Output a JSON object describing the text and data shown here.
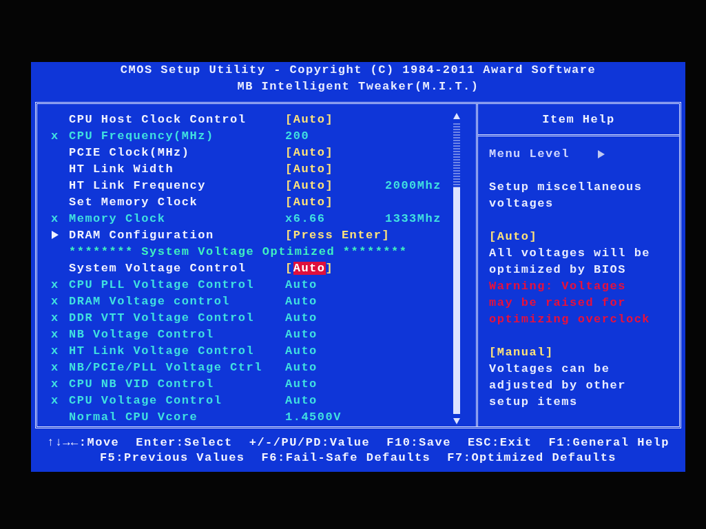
{
  "header": {
    "title": "CMOS Setup Utility - Copyright (C) 1984-2011 Award Software",
    "subtitle": "MB Intelligent Tweaker(M.I.T.)"
  },
  "settings": [
    {
      "kind": "setting",
      "label": "CPU Host Clock Control",
      "value": "[Auto]",
      "disabled": false,
      "selected": false
    },
    {
      "kind": "setting",
      "prefix": "x",
      "label": "CPU Frequency(MHz)",
      "value": "200",
      "disabled": true,
      "selected": false
    },
    {
      "kind": "setting",
      "label": "PCIE Clock(MHz)",
      "value": "[Auto]",
      "disabled": false,
      "selected": false
    },
    {
      "kind": "setting",
      "label": "HT Link Width",
      "value": "[Auto]",
      "disabled": false,
      "selected": false
    },
    {
      "kind": "setting",
      "label": "HT Link Frequency",
      "value": "[Auto]",
      "extra": "2000Mhz",
      "disabled": false,
      "selected": false
    },
    {
      "kind": "setting",
      "label": "Set Memory Clock",
      "value": "[Auto]",
      "disabled": false,
      "selected": false
    },
    {
      "kind": "setting",
      "prefix": "x",
      "label": "Memory Clock",
      "value": "x6.66",
      "extra": "1333Mhz",
      "disabled": true,
      "selected": false
    },
    {
      "kind": "submenu",
      "label": "DRAM Configuration",
      "value": "[Press Enter]",
      "disabled": false,
      "selected": false
    },
    {
      "kind": "heading",
      "label": "******** System Voltage Optimized ********"
    },
    {
      "kind": "setting",
      "label": "System Voltage Control",
      "value": "[Auto]",
      "disabled": false,
      "selected": true
    },
    {
      "kind": "setting",
      "prefix": "x",
      "label": "CPU PLL Voltage Control",
      "value": "Auto",
      "disabled": true,
      "selected": false
    },
    {
      "kind": "setting",
      "prefix": "x",
      "label": "DRAM Voltage control",
      "value": "Auto",
      "disabled": true,
      "selected": false
    },
    {
      "kind": "setting",
      "prefix": "x",
      "label": "DDR VTT Voltage Control",
      "value": "Auto",
      "disabled": true,
      "selected": false
    },
    {
      "kind": "setting",
      "prefix": "x",
      "label": "NB Voltage Control",
      "value": "Auto",
      "disabled": true,
      "selected": false
    },
    {
      "kind": "setting",
      "prefix": "x",
      "label": "HT Link Voltage Control",
      "value": "Auto",
      "disabled": true,
      "selected": false
    },
    {
      "kind": "setting",
      "prefix": "x",
      "label": "NB/PCIe/PLL Voltage Ctrl",
      "value": "Auto",
      "disabled": true,
      "selected": false
    },
    {
      "kind": "setting",
      "prefix": "x",
      "label": "CPU NB VID Control",
      "value": "Auto",
      "disabled": true,
      "selected": false
    },
    {
      "kind": "setting",
      "prefix": "x",
      "label": "CPU Voltage Control",
      "value": "Auto",
      "disabled": true,
      "selected": false
    },
    {
      "kind": "info",
      "label": "Normal CPU Vcore",
      "value": "1.4500V",
      "disabled": true,
      "selected": false
    }
  ],
  "item_help": {
    "title": "Item Help",
    "entries": [
      {
        "kind": "menu-level",
        "text": "Menu Level"
      },
      {
        "kind": "text",
        "text": "Setup miscellaneous voltages"
      },
      {
        "kind": "option",
        "text": "[Auto]"
      },
      {
        "kind": "text",
        "text": "All voltages will be optimized by BIOS"
      },
      {
        "kind": "warning",
        "text": "Warning: Voltages may be raised for optimizing overclock"
      },
      {
        "kind": "option",
        "text": "[Manual]"
      },
      {
        "kind": "text",
        "text": "Voltages can be adjusted by other setup items"
      }
    ]
  },
  "footer": {
    "lines": [
      [
        "↑↓→←:Move",
        "Enter:Select",
        "+/-/PU/PD:Value",
        "F10:Save",
        "ESC:Exit",
        "F1:General Help"
      ],
      [
        "F5:Previous Values",
        "F6:Fail-Safe Defaults",
        "F7:Optimized Defaults"
      ]
    ]
  }
}
